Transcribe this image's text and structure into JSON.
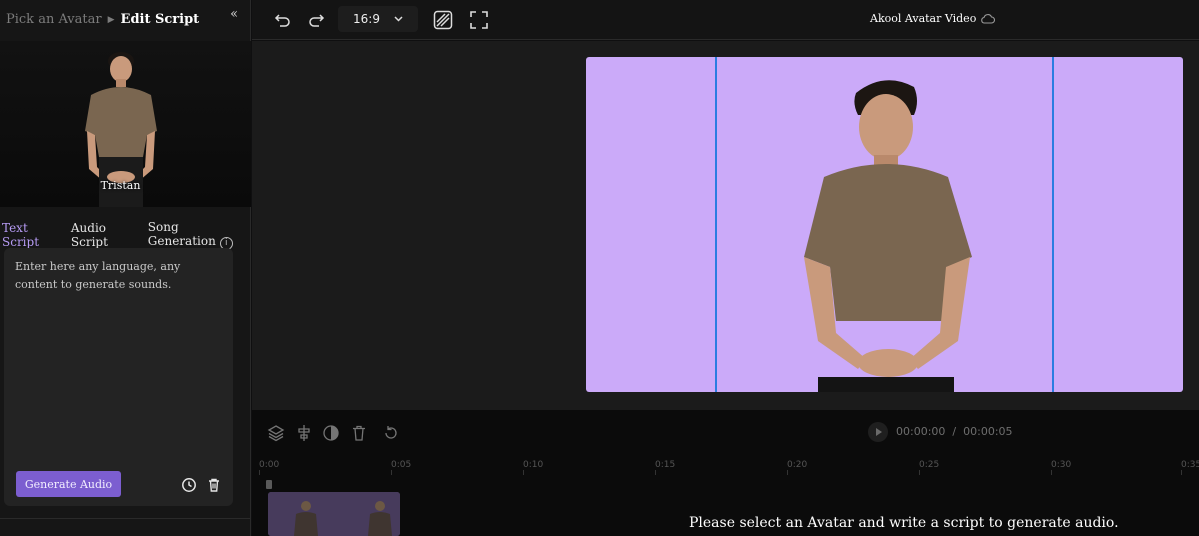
{
  "breadcrumb": {
    "prev": "Pick an Avatar",
    "current": "Edit Script"
  },
  "avatar": {
    "name": "Tristan"
  },
  "script_tabs": [
    {
      "label": "Text Script",
      "active": true
    },
    {
      "label": "Audio Script",
      "active": false
    },
    {
      "label": "Song Generation",
      "active": false
    }
  ],
  "editor": {
    "placeholder": "Enter here any language, any content to generate sounds.",
    "generate_label": "Generate Audio"
  },
  "toolbar": {
    "aspect_ratio": "16:9",
    "project_title": "Akool Avatar Video"
  },
  "timeline": {
    "current_time": "00:00:00",
    "separator": "/",
    "total_time": "00:00:05",
    "ticks": [
      "0:00",
      "0:05",
      "0:10",
      "0:15",
      "0:20",
      "0:25",
      "0:30",
      "0:35"
    ],
    "hint": "Please select an Avatar and write a script to generate audio."
  },
  "colors": {
    "accent": "#7c5ed0",
    "canvas_bg": "#cbaaf9",
    "guide": "#2a7de1"
  }
}
